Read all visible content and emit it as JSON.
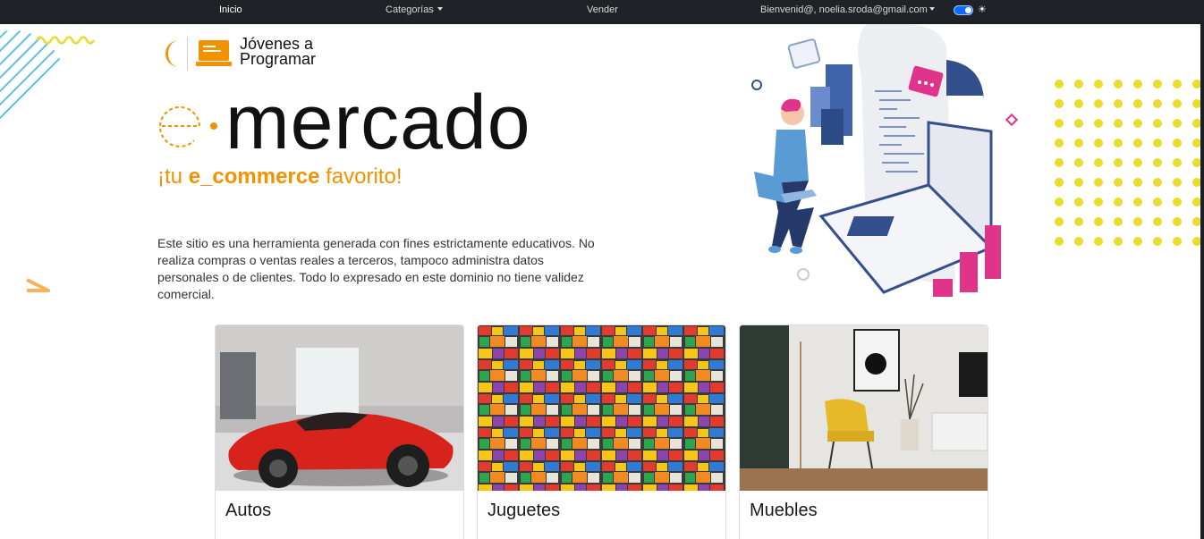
{
  "navbar": {
    "items": [
      {
        "label": "Inicio",
        "active": true
      },
      {
        "label": "Categorías",
        "dropdown": true
      },
      {
        "label": "Vender"
      }
    ],
    "user_label": "Bienvenid@, noelia.sroda@gmail.com",
    "theme_icon": "sun-icon"
  },
  "logo": {
    "text": "Jóvenes a\nProgramar"
  },
  "hero": {
    "title": "mercado",
    "tagline_prefix": "¡tu ",
    "tagline_bold": "e_commerce",
    "tagline_suffix": " favorito!",
    "description": "Este sitio es una herramienta generada con fines estrictamente educativos. No realiza compras o ventas reales a terceros, tampoco administra datos personales o de clientes. Todo lo expresado en este dominio no tiene validez comercial."
  },
  "categories": [
    {
      "name": "Autos"
    },
    {
      "name": "Juguetes"
    },
    {
      "name": "Muebles"
    }
  ],
  "colors": {
    "accent": "#f29200",
    "navbar": "#1f2328",
    "dots": "#e8dc2e",
    "illustration_pink": "#e0338a",
    "illustration_blue": "#34508c"
  }
}
